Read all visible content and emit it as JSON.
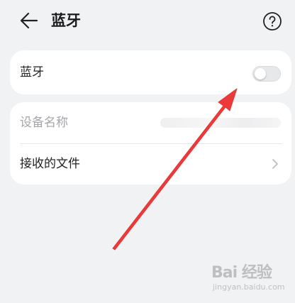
{
  "header": {
    "title": "蓝牙",
    "back_icon": "arrow-left-icon",
    "help_icon": "question-circle-icon"
  },
  "bluetooth_card": {
    "label": "蓝牙",
    "toggle_on": false
  },
  "device_card": {
    "device_name_label": "设备名称",
    "received_files_label": "接收的文件",
    "chevron_icon": "chevron-right-icon"
  },
  "annotation": {
    "arrow_color": "#ec3a3a"
  },
  "watermark": {
    "text": "Bai 经验",
    "sub": "jingyan.baidu.com"
  }
}
